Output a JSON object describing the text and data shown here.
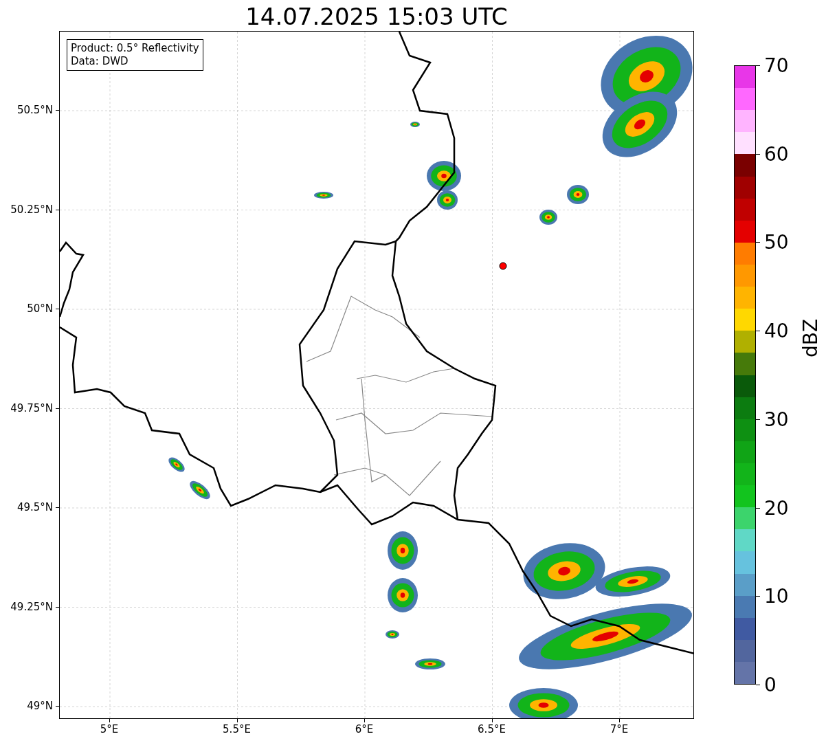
{
  "title": "14.07.2025 15:03 UTC",
  "info_box": [
    "Product: 0.5° Reflectivity",
    "Data: DWD"
  ],
  "map": {
    "x_ticks": [
      "5°E",
      "5.5°E",
      "6°E",
      "6.5°E",
      "7°E"
    ],
    "y_ticks": [
      "50.5°N",
      "50.25°N",
      "50°N",
      "49.75°N",
      "49.5°N",
      "49.25°N",
      "49°N"
    ]
  },
  "colorbar": {
    "label": "dBZ",
    "ticks": [
      "70",
      "60",
      "50",
      "40",
      "30",
      "20",
      "10",
      "0"
    ],
    "bands": [
      {
        "color": "#e836e8"
      },
      {
        "color": "#ff68ff"
      },
      {
        "color": "#ffb4ff"
      },
      {
        "color": "#ffe0ff"
      },
      {
        "color": "#7a0000"
      },
      {
        "color": "#a00000"
      },
      {
        "color": "#c00000"
      },
      {
        "color": "#e40000"
      },
      {
        "color": "#ff7c00"
      },
      {
        "color": "#ff9800"
      },
      {
        "color": "#ffb400"
      },
      {
        "color": "#ffd800"
      },
      {
        "color": "#b0b000"
      },
      {
        "color": "#467a0a"
      },
      {
        "color": "#0a5a0a"
      },
      {
        "color": "#0c7c10"
      },
      {
        "color": "#0e9012"
      },
      {
        "color": "#10a416"
      },
      {
        "color": "#12b41a"
      },
      {
        "color": "#12c41e"
      },
      {
        "color": "#3cd46c"
      },
      {
        "color": "#60d8c6"
      },
      {
        "color": "#66c2de"
      },
      {
        "color": "#5a9ec8"
      },
      {
        "color": "#4a7ab2"
      },
      {
        "color": "#405aa2"
      },
      {
        "color": "#52669e"
      },
      {
        "color": "#6474a8"
      }
    ]
  }
}
